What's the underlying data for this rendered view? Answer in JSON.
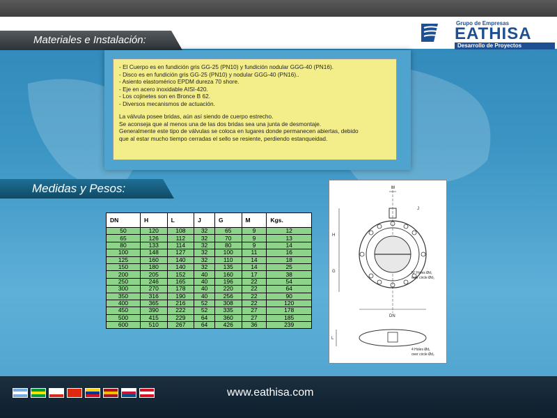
{
  "header": {
    "title": "Materiales e Instalación:"
  },
  "logo": {
    "group": "Grupo de Empresas",
    "name": "EATHISA",
    "tagline": "Desarrollo de Proyectos"
  },
  "materials": {
    "bullets": [
      "- El Cuerpo es en fundición gris GG-25 (PN10) y fundición nodular GGG-40 (PN16).",
      "- Disco es en fundición gris GG-25 (PN10) y nodular GGG-40 (PN16)..",
      "- Asiento elastomérico EPDM dureza 70 shore.",
      "- Eje en acero inoxidable AISI-420.",
      "- Los cojinetes son en Bronce B 62.",
      "- Diversos mecanismos de actuación."
    ],
    "paragraph": [
      "La válvula posee bridas, aún así siendo de cuerpo estrecho.",
      "Se aconseja que al menos una de las dos bridas sea una junta de desmontaje.",
      "Generalmente este tipo de válvulas se coloca en lugares donde permanecen abiertas, debido",
      "que al estar mucho tiempo cerradas el sello se resiente, perdiendo estanqueidad."
    ]
  },
  "section2": {
    "title": "Medidas y Pesos:"
  },
  "table": {
    "headers": [
      "DN",
      "H",
      "L",
      "J",
      "G",
      "M",
      "Kgs."
    ],
    "rows": [
      [
        "50",
        "120",
        "108",
        "32",
        "65",
        "9",
        "12"
      ],
      [
        "65",
        "126",
        "112",
        "32",
        "70",
        "9",
        "13"
      ],
      [
        "80",
        "133",
        "114",
        "32",
        "80",
        "9",
        "14"
      ],
      [
        "100",
        "148",
        "127",
        "32",
        "100",
        "11",
        "16"
      ],
      [
        "125",
        "160",
        "140",
        "32",
        "110",
        "14",
        "18"
      ],
      [
        "150",
        "180",
        "140",
        "32",
        "135",
        "14",
        "25"
      ],
      [
        "200",
        "205",
        "152",
        "40",
        "160",
        "17",
        "38"
      ],
      [
        "250",
        "246",
        "165",
        "40",
        "196",
        "22",
        "54"
      ],
      [
        "300",
        "270",
        "178",
        "40",
        "220",
        "22",
        "64"
      ],
      [
        "350",
        "316",
        "190",
        "40",
        "256",
        "22",
        "90"
      ],
      [
        "400",
        "365",
        "216",
        "52",
        "308",
        "22",
        "120"
      ],
      [
        "450",
        "390",
        "222",
        "52",
        "335",
        "27",
        "178"
      ],
      [
        "500",
        "415",
        "229",
        "64",
        "360",
        "27",
        "185"
      ],
      [
        "600",
        "510",
        "267",
        "64",
        "426",
        "36",
        "239"
      ]
    ]
  },
  "drawing": {
    "labels": {
      "m": "M",
      "j": "J",
      "h": "H",
      "g": "G",
      "dn": "DN",
      "l": "L",
      "note1a": "N° Holes Ød₁",
      "note1b": "over circle Ød₂",
      "note2a": "4 Holes Ød₁",
      "note2b": "over circle Ød₂"
    }
  },
  "footer": {
    "url": "www.eathisa.com"
  },
  "flags": [
    {
      "name": "argentina",
      "colors": [
        "#74acdf",
        "#ffffff",
        "#74acdf"
      ]
    },
    {
      "name": "brazil",
      "colors": [
        "#009c3b",
        "#ffdf00",
        "#009c3b"
      ]
    },
    {
      "name": "chile",
      "colors": [
        "#ffffff",
        "#ffffff",
        "#d52b1e"
      ]
    },
    {
      "name": "china",
      "colors": [
        "#de2910",
        "#de2910",
        "#de2910"
      ]
    },
    {
      "name": "colombia",
      "colors": [
        "#fcd116",
        "#003893",
        "#ce1126"
      ]
    },
    {
      "name": "spain",
      "colors": [
        "#aa151b",
        "#f1bf00",
        "#aa151b"
      ]
    },
    {
      "name": "panama",
      "colors": [
        "#ffffff",
        "#d21034",
        "#005293"
      ]
    },
    {
      "name": "peru",
      "colors": [
        "#d91023",
        "#ffffff",
        "#d91023"
      ]
    }
  ]
}
